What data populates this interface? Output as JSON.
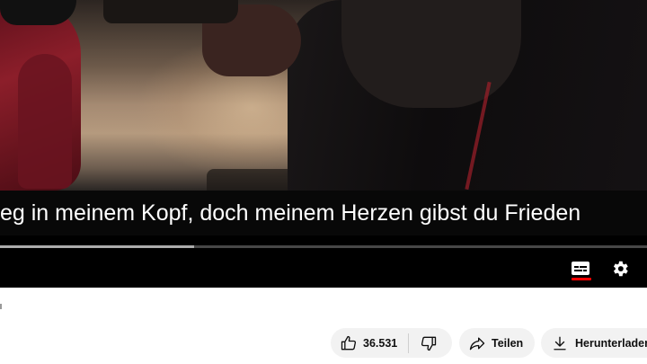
{
  "player": {
    "caption": "eg in meinem Kopf, doch meinem Herzen gibst du Frieden",
    "progress": {
      "played_fraction": 0.0,
      "loaded_fraction": 0.3
    },
    "controls": {
      "subtitles_icon": "subtitles-icon",
      "settings_icon": "gear-icon",
      "subtitles_active": true
    }
  },
  "actions": {
    "like_count": "36.531",
    "share_label": "Teilen",
    "download_label": "Herunterladen"
  },
  "colors": {
    "accent": "#ff0000",
    "pill_bg": "#f2f2f2",
    "text": "#0f0f0f"
  }
}
